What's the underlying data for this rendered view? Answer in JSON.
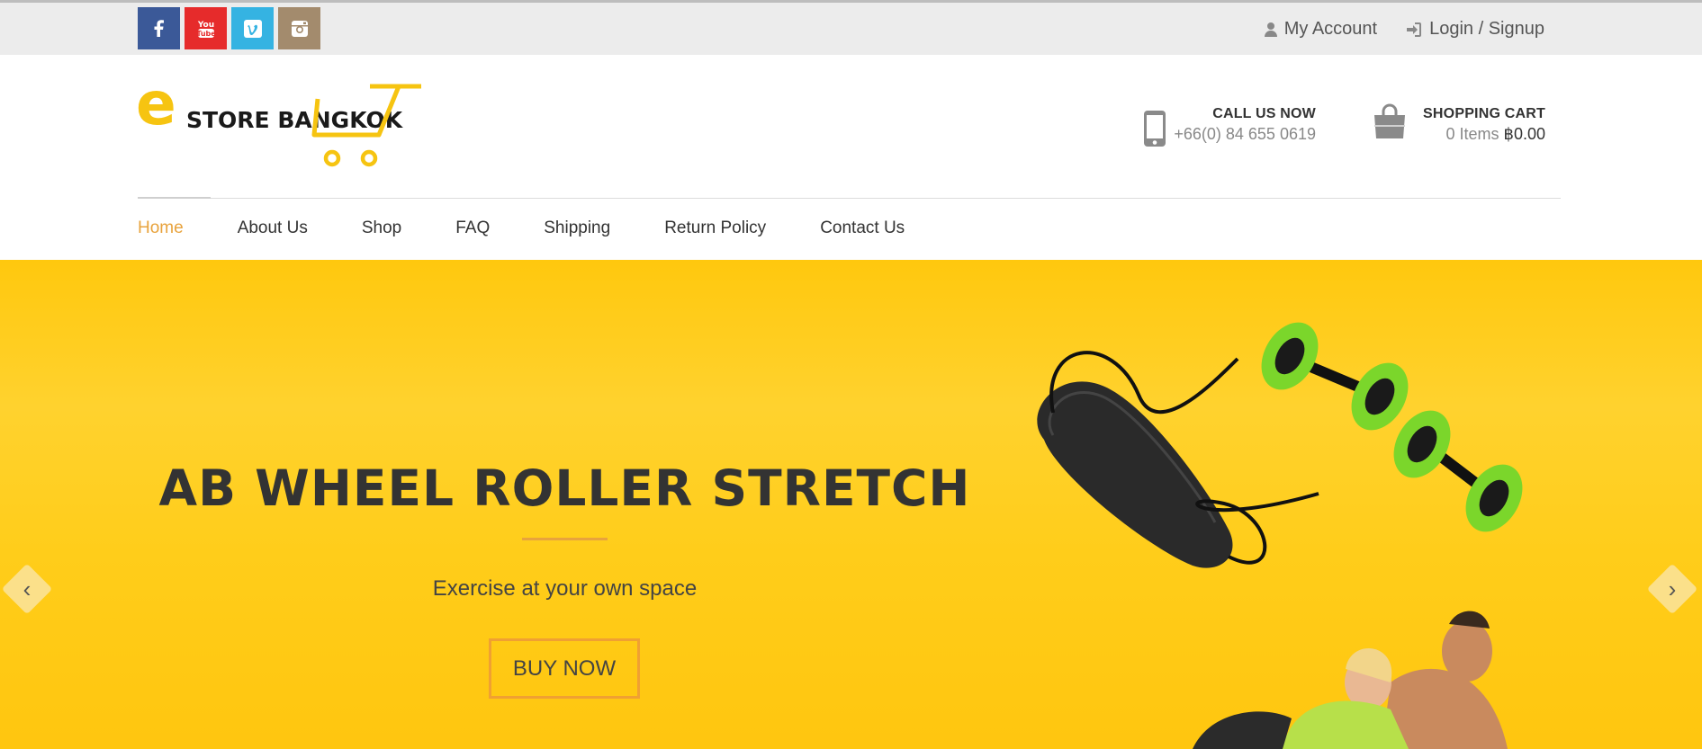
{
  "topbar": {
    "social": [
      {
        "name": "facebook-icon",
        "color": "#3b5998"
      },
      {
        "name": "youtube-icon",
        "color": "#e62b2b"
      },
      {
        "name": "vimeo-icon",
        "color": "#35b3e2"
      },
      {
        "name": "instagram-icon",
        "color": "#a38b6d"
      }
    ],
    "my_account": "My Account",
    "login": "Login / Signup"
  },
  "header": {
    "logo_text": "STORE BANGKOK",
    "logo_letter": "e",
    "call_label": "CALL US NOW",
    "phone": "+66(0) 84 655 0619",
    "cart_label": "SHOPPING CART",
    "cart_items": "0 Items",
    "cart_total": "฿0.00"
  },
  "nav": {
    "items": [
      "Home",
      "About Us",
      "Shop",
      "FAQ",
      "Shipping",
      "Return Policy",
      "Contact Us"
    ],
    "active": "Home"
  },
  "hero": {
    "title": "AB WHEEL ROLLER STRETCH",
    "subtitle": "Exercise at your own space",
    "button": "BUY NOW",
    "prev": "‹",
    "next": "›"
  },
  "colors": {
    "accent": "#e8a33d",
    "hero_bg": "#ffcd1a",
    "topbar_bg": "#ececec"
  }
}
